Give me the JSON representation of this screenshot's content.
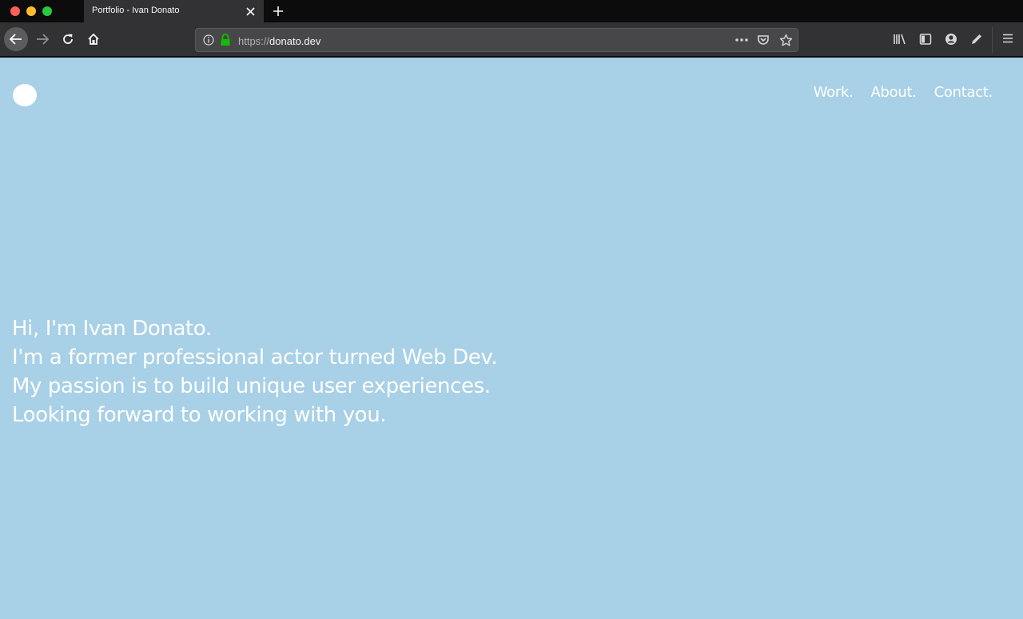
{
  "browser": {
    "tab": {
      "title": "Portfolio - Ivan Donato"
    },
    "url": {
      "scheme": "https://",
      "host": "donato.dev"
    },
    "icons": {
      "close": "close-icon",
      "new_tab": "plus-icon",
      "back": "arrow-left-icon",
      "forward": "arrow-right-icon",
      "reload": "reload-icon",
      "home": "home-icon",
      "info": "info-icon",
      "lock": "lock-icon",
      "more": "ellipsis-icon",
      "pocket": "pocket-icon",
      "bookmark": "star-icon",
      "library": "library-icon",
      "sidebar": "sidebar-icon",
      "account": "account-icon",
      "edit": "pencil-icon",
      "menu": "hamburger-menu-icon"
    },
    "colors": {
      "lock": "#12bc00",
      "chrome": "#323234",
      "tabstrip": "#0c0c0d"
    }
  },
  "site": {
    "background": "#a8d0e6",
    "nav": [
      {
        "label": "Work."
      },
      {
        "label": "About."
      },
      {
        "label": "Contact."
      }
    ],
    "hero_lines": [
      "Hi, I'm Ivan Donato.",
      "I'm a former professional actor turned Web Dev.",
      "My passion is to build unique user experiences.",
      "Looking forward to working with you."
    ]
  }
}
